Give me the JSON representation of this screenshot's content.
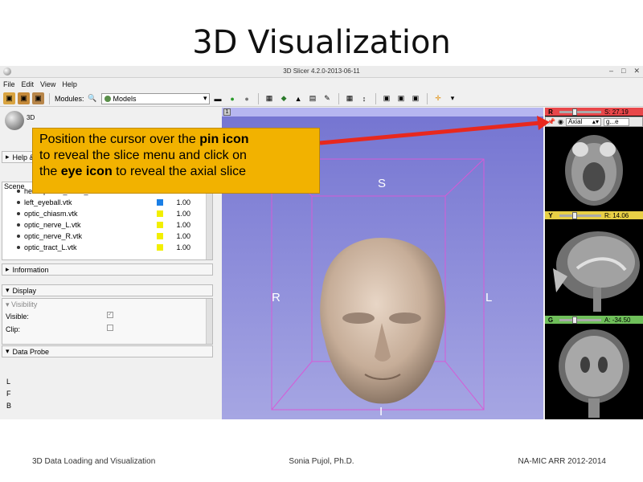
{
  "slide": {
    "title": "3D Visualization",
    "footer_left": "3D Data Loading and Visualization",
    "footer_center": "Sonia Pujol, Ph.D.",
    "footer_right": "NA-MIC ARR 2012-2014"
  },
  "window": {
    "title": "3D Slicer 4.2.0-2013-06-11",
    "controls": [
      "–",
      "□",
      "✕"
    ]
  },
  "menu": [
    "File",
    "Edit",
    "View",
    "Help"
  ],
  "toolbar": {
    "modules_label": "Modules:",
    "module_value": "Models"
  },
  "left_panel": {
    "module_header": "3D",
    "help_label": "Help &",
    "scene_label": "Scene",
    "models": [
      {
        "name": "hemispheric_white_matter.vtk",
        "color": "",
        "opacity": "1.00"
      },
      {
        "name": "left_eyeball.vtk",
        "color": "#1a7fe6",
        "opacity": "1.00"
      },
      {
        "name": "optic_chiasm.vtk",
        "color": "#f2ef00",
        "opacity": "1.00"
      },
      {
        "name": "optic_nerve_L.vtk",
        "color": "#f2ef00",
        "opacity": "1.00"
      },
      {
        "name": "optic_nerve_R.vtk",
        "color": "#f2ef00",
        "opacity": "1.00"
      },
      {
        "name": "optic_tract_L.vtk",
        "color": "#f2ef00",
        "opacity": "1.00"
      }
    ],
    "information_label": "Information",
    "display_label": "Display",
    "visibility_label": "Visibility",
    "visible_label": "Visible:",
    "clip_label": "Clip:",
    "data_probe_label": "Data Probe",
    "probe_letters": [
      "L",
      "F",
      "B"
    ]
  },
  "view3d": {
    "number": "1",
    "axis_S": "S",
    "axis_R": "R",
    "axis_L": "L",
    "axis_I": "I"
  },
  "slices": {
    "red": {
      "letter": "R",
      "value": "S: 27.19",
      "color": "#e8474a"
    },
    "yellow": {
      "letter": "Y",
      "value": "R: 14.06",
      "color": "#e8d046"
    },
    "green": {
      "letter": "G",
      "value": "A: -34.50",
      "color": "#6fbf5a"
    },
    "orientation": "Axial",
    "volume_short": "g...e"
  },
  "callout": {
    "line1_pre": "Position the cursor over the ",
    "line1_bold": "pin icon",
    "line2": "to reveal the slice menu and click on",
    "line3_pre": "the ",
    "line3_bold": "eye icon",
    "line3_post": " to reveal the axial slice"
  }
}
